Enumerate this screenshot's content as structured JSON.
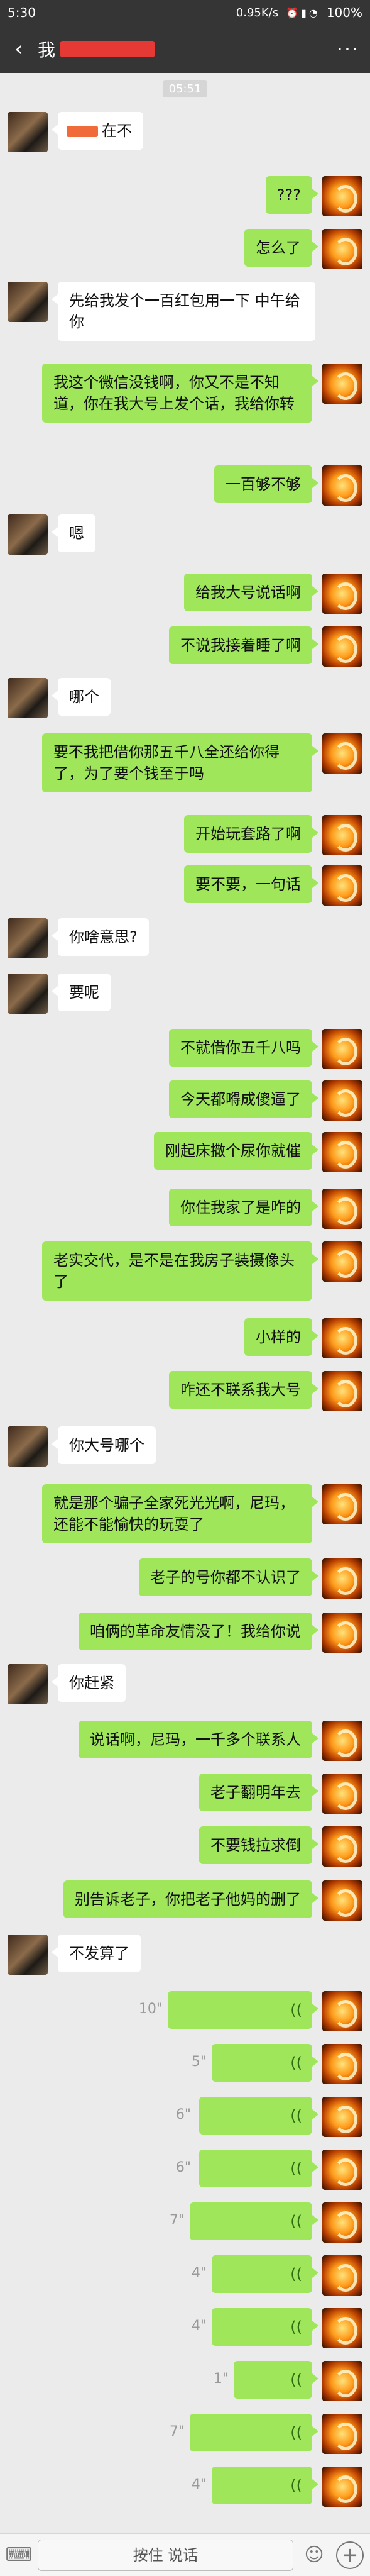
{
  "status": {
    "time": "5:30",
    "net": "0.95K/s",
    "battery": "100%"
  },
  "header": {
    "name_visible": "我"
  },
  "timestamp": "05:51",
  "messages": [
    {
      "side": "recv",
      "text": "在不"
    },
    {
      "side": "sent",
      "text": "???"
    },
    {
      "side": "sent",
      "text": "怎么了"
    },
    {
      "side": "recv",
      "text": "先给我发个一百红包用一下  中午给你"
    },
    {
      "side": "sent",
      "text": "我这个微信没钱啊，你又不是不知道，你在我大号上发个话，我给你转"
    },
    {
      "side": "sent",
      "text": "一百够不够"
    },
    {
      "side": "recv",
      "text": "嗯"
    },
    {
      "side": "sent",
      "text": "给我大号说话啊"
    },
    {
      "side": "sent",
      "text": "不说我接着睡了啊"
    },
    {
      "side": "recv",
      "text": "哪个"
    },
    {
      "side": "sent",
      "text": "要不我把借你那五千八全还给你得了，为了要个钱至于吗"
    },
    {
      "side": "sent",
      "text": "开始玩套路了啊"
    },
    {
      "side": "sent",
      "text": "要不要，一句话"
    },
    {
      "side": "recv",
      "text": "你啥意思?"
    },
    {
      "side": "recv",
      "text": "要呢"
    },
    {
      "side": "sent",
      "text": "不就借你五千八吗"
    },
    {
      "side": "sent",
      "text": "今天都嘚成傻逼了"
    },
    {
      "side": "sent",
      "text": "刚起床撒个尿你就催"
    },
    {
      "side": "sent",
      "text": "你住我家了是咋的"
    },
    {
      "side": "sent",
      "text": "老实交代，是不是在我房子装摄像头了"
    },
    {
      "side": "sent",
      "text": "小样的"
    },
    {
      "side": "sent",
      "text": "咋还不联系我大号"
    },
    {
      "side": "recv",
      "text": "你大号哪个"
    },
    {
      "side": "sent",
      "text": "就是那个骗子全家死光光啊，尼玛，还能不能愉快的玩耍了"
    },
    {
      "side": "sent",
      "text": "老子的号你都不认识了"
    },
    {
      "side": "sent",
      "text": "咱俩的革命友情没了！我给你说"
    },
    {
      "side": "recv",
      "text": "你赶紧"
    },
    {
      "side": "sent",
      "text": "说话啊，尼玛，一千多个联系人"
    },
    {
      "side": "sent",
      "text": "老子翻明年去"
    },
    {
      "side": "sent",
      "text": "不要钱拉求倒"
    },
    {
      "side": "sent",
      "text": "别告诉老子，你把老子他妈的删了"
    },
    {
      "side": "recv",
      "text": "不发算了"
    }
  ],
  "voice_messages": [
    {
      "duration": "10\""
    },
    {
      "duration": "5\""
    },
    {
      "duration": "6\""
    },
    {
      "duration": "6\""
    },
    {
      "duration": "7\""
    },
    {
      "duration": "4\""
    },
    {
      "duration": "4\""
    },
    {
      "duration": "1\""
    },
    {
      "duration": "7\""
    },
    {
      "duration": "4\""
    }
  ],
  "input": {
    "hold_to_talk": "按住 说话"
  },
  "colors": {
    "sent_bubble": "#9fe65a",
    "received_bubble": "#ffffff",
    "background": "#ebebeb",
    "title_bar": "#353535"
  },
  "icons": {
    "back": "back-arrow-icon",
    "more": "more-dots-icon",
    "keyboard": "keyboard-icon",
    "emoji": "emoji-icon",
    "plus": "plus-icon",
    "voice_wave": "voice-wave-icon"
  }
}
